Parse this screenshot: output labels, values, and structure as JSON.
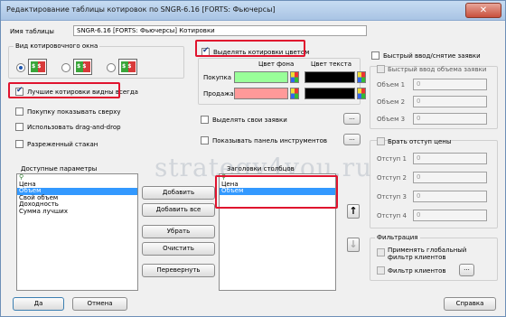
{
  "window": {
    "title": "Редактирование таблицы котировок по SNGR-6.16 [FORTS: Фьючерсы]",
    "close_label": "✕"
  },
  "table_name": {
    "label": "Имя таблицы",
    "value": "SNGR-6.16 [FORTS: Фьючерсы] Котировки"
  },
  "view_group": {
    "label": "Вид котировочного окна",
    "icon_text": [
      "$ $",
      "$ $",
      "$ $"
    ]
  },
  "options": {
    "best_quotes": "Лучшие котировки видны всегда",
    "buy_top": "Покупку показывать сверху",
    "drag_drop": "Использовать drag-and-drop",
    "sparse": "Разреженный стакан",
    "highlight_color": "Выделять котировки цветом",
    "highlight_own": "Выделять свои заявки",
    "show_toolbar": "Показывать панель инструментов"
  },
  "colors": {
    "bg_header": "Цвет фона",
    "text_header": "Цвет текста",
    "buy_label": "Покупка",
    "sell_label": "Продажа",
    "buy_bg": "#99ff99",
    "sell_bg": "#ff9999",
    "text_color": "#000000"
  },
  "available": {
    "label": "Доступные параметры",
    "items": [
      "Цена",
      "Объем",
      "Свой объем",
      "Доходность",
      "Сумма лучших"
    ],
    "selected_index": 1
  },
  "columns": {
    "label": "Заголовки столбцов",
    "items": [
      "Цена",
      "Объем"
    ],
    "selected_index": 1
  },
  "buttons": {
    "add": "Добавить",
    "add_all": "Добавить все",
    "remove": "Убрать",
    "clear": "Очистить",
    "flip": "Перевернуть",
    "ok": "Да",
    "cancel": "Отмена",
    "help": "Справка",
    "dots": "...",
    "up": "↑",
    "down": "↓"
  },
  "quick_order": {
    "label": "Быстрый ввод/снятие заявки",
    "volume_label": "Быстрый ввод объема заявки",
    "rows": [
      {
        "label": "Объем 1",
        "value": "0"
      },
      {
        "label": "Объем 2",
        "value": "0"
      },
      {
        "label": "Объем 3",
        "value": "0"
      }
    ]
  },
  "offset": {
    "label": "Брать отступ цены",
    "rows": [
      {
        "label": "Отступ 1",
        "value": "0"
      },
      {
        "label": "Отступ 2",
        "value": "0"
      },
      {
        "label": "Отступ 3",
        "value": "0"
      },
      {
        "label": "Отступ 4",
        "value": "0"
      }
    ]
  },
  "filter": {
    "label": "Фильтрация",
    "global": "Применять глобальный фильтр клиентов",
    "clients": "Фильтр клиентов"
  },
  "watermark": "strategy4you.ru"
}
